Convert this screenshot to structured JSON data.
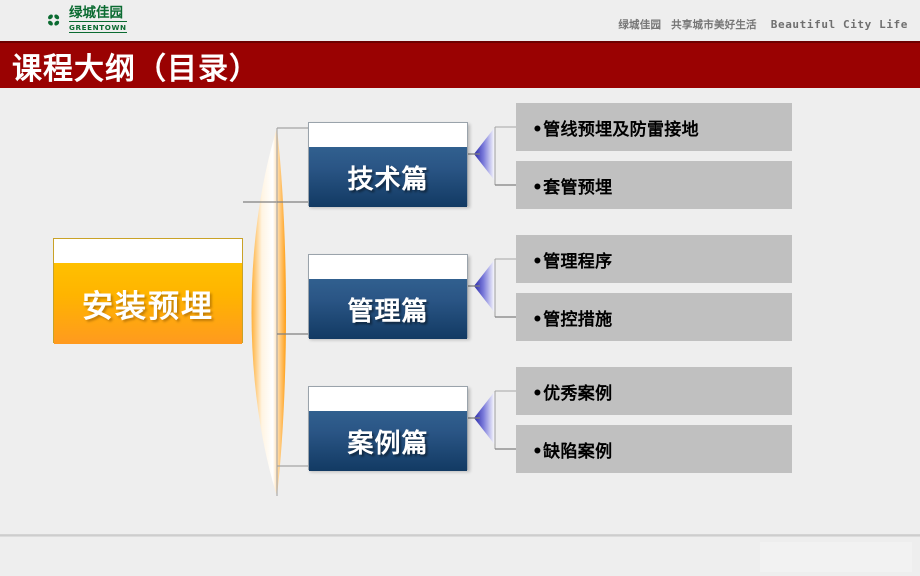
{
  "header": {
    "logo": {
      "icon": "greentown-clover-logo",
      "cn_name": "绿城佳园",
      "en_name": "GREENTOWN"
    },
    "tagline": {
      "brand": "绿城佳园",
      "slogan_cn": "共享城市美好生活",
      "slogan_en": "Beautiful City Life"
    }
  },
  "title_bar": {
    "title": "课程大纲（目录）",
    "background": "#9A0202",
    "text_color": "#FFFFFF"
  },
  "diagram": {
    "root": {
      "label": "安装预埋",
      "color": "#FFB400"
    },
    "branches": [
      {
        "label": "技术篇",
        "color": "#2A5585",
        "arrow": "left-triangle-arrow",
        "leaves": [
          {
            "bullet": "•",
            "label": "管线预埋及防雷接地"
          },
          {
            "bullet": "•",
            "label": "套管预埋"
          }
        ]
      },
      {
        "label": "管理篇",
        "color": "#2A5585",
        "arrow": "left-triangle-arrow",
        "leaves": [
          {
            "bullet": "•",
            "label": "管理程序"
          },
          {
            "bullet": "•",
            "label": "管控措施"
          }
        ]
      },
      {
        "label": "案例篇",
        "color": "#2A5585",
        "arrow": "left-triangle-arrow",
        "leaves": [
          {
            "bullet": "•",
            "label": "优秀案例"
          },
          {
            "bullet": "•",
            "label": "缺陷案例"
          }
        ]
      }
    ],
    "leaf_color": "#C0C0C0",
    "connector_color": "#808080",
    "lens_color": "#FFA732"
  }
}
